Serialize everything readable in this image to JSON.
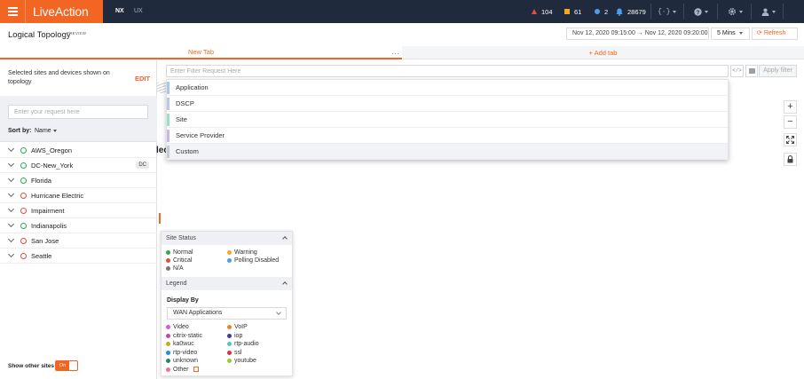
{
  "app": {
    "brand": "LiveAction",
    "nav_tabs": [
      "NX",
      "UX"
    ]
  },
  "alerts": {
    "critical_count": "104",
    "warning_count": "61",
    "info_count": "2",
    "notification_count": "28679"
  },
  "header": {
    "title": "Logical Topology",
    "preview_tag": "PREVIEW",
    "time_range": "Nov 12, 2020 09:15:00 → Nov 12, 2020 09:20:00",
    "interval": "5 Mins",
    "refresh_label": "Refresh"
  },
  "tabs": {
    "active_tab": "New Tab",
    "more_glyph": "…",
    "add_tab_label": "+ Add tab"
  },
  "sidebar": {
    "description": "Selected sites and devices shown on topology",
    "edit_label": "EDIT",
    "search_placeholder": "Enter your request here",
    "sort_label": "Sort by:",
    "sort_value": "Name",
    "sites": [
      {
        "name": "AWS_Oregon",
        "status": "normal"
      },
      {
        "name": "DC-New_York",
        "status": "normal",
        "badge": "DC"
      },
      {
        "name": "Florida",
        "status": "normal"
      },
      {
        "name": "Hurricane Electric",
        "status": "critical"
      },
      {
        "name": "Impairment",
        "status": "critical"
      },
      {
        "name": "Indianapolis",
        "status": "normal"
      },
      {
        "name": "San Jose",
        "status": "critical"
      },
      {
        "name": "Seattle",
        "status": "critical"
      }
    ],
    "show_other_label": "Show other sites",
    "toggle_label": "On"
  },
  "filter": {
    "placeholder": "Enter Filter Request Here",
    "code_glyph": "</>",
    "apply_label": "Apply filter",
    "options": [
      {
        "label": "Application",
        "color": "#a9c7ea"
      },
      {
        "label": "DSCP",
        "color": "#b6c9e8"
      },
      {
        "label": "Site",
        "color": "#9fdcc9"
      },
      {
        "label": "Service Provider",
        "color": "#c9b9e2"
      },
      {
        "label": "Custom",
        "color": "#c6cbd2"
      }
    ]
  },
  "canvas": {
    "label_fragment": "lec"
  },
  "zoom": {
    "zoom_in": "+",
    "zoom_out": "−",
    "fit": "✖",
    "lock": "lock"
  },
  "site_status": {
    "title": "Site Status",
    "items": [
      {
        "label": "Normal",
        "color": "#2eaa4a"
      },
      {
        "label": "Warning",
        "color": "#f5a623"
      },
      {
        "label": "Critical",
        "color": "#e74c3c"
      },
      {
        "label": "Polling Disabled",
        "color": "#4a9eea"
      },
      {
        "label": "N/A",
        "color": "#777777"
      }
    ]
  },
  "legend": {
    "title": "Legend",
    "display_by_label": "Display By",
    "display_by_value": "WAN Applications",
    "items": [
      {
        "label": "Video",
        "color": "#d35bd8"
      },
      {
        "label": "VoIP",
        "color": "#e0892b"
      },
      {
        "label": "citrix-static",
        "color": "#c447a6"
      },
      {
        "label": "iop",
        "color": "#3b3f9e"
      },
      {
        "label": "ka0wuc",
        "color": "#b9b020"
      },
      {
        "label": "rtp-audio",
        "color": "#4fc7c0"
      },
      {
        "label": "rtp-video",
        "color": "#1f8fd8"
      },
      {
        "label": "ssl",
        "color": "#d2344f"
      },
      {
        "label": "unknown",
        "color": "#1f8a6a"
      },
      {
        "label": "youtube",
        "color": "#9ccd2f"
      },
      {
        "label": "Other",
        "color": "#ee6f9a"
      }
    ]
  }
}
